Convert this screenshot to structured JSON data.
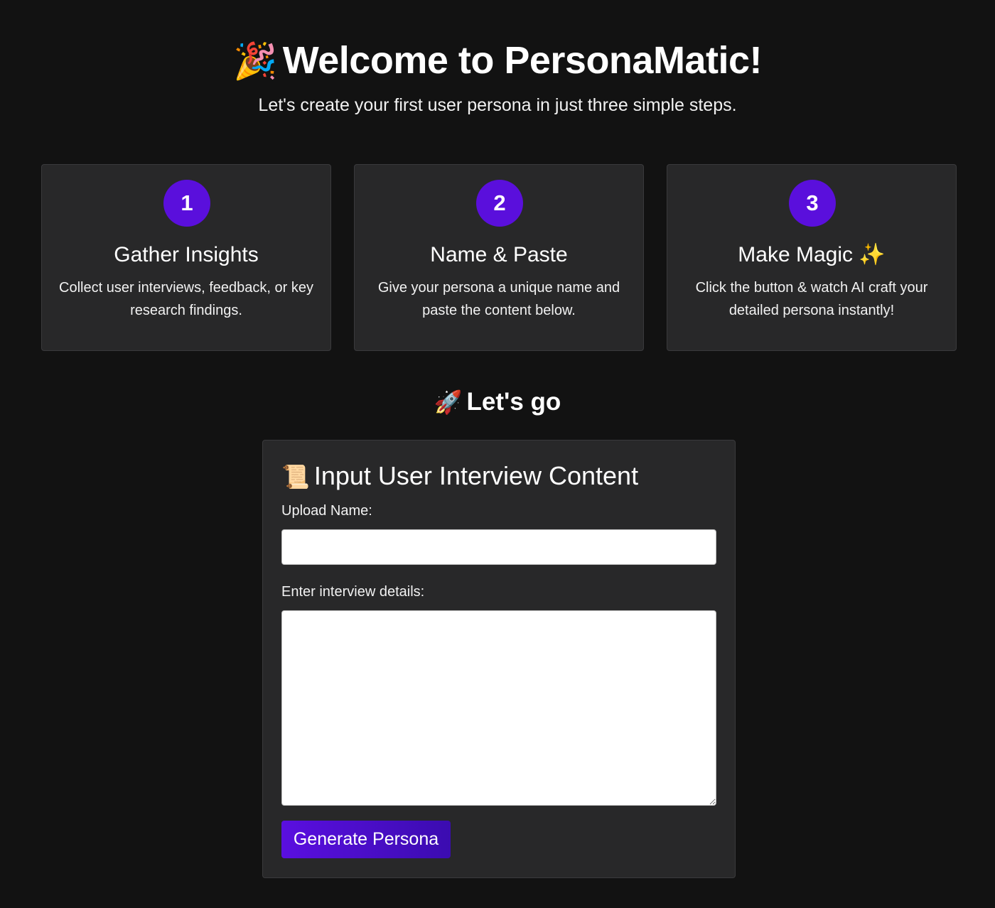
{
  "hero": {
    "emoji": "🎉",
    "title": "Welcome to PersonaMatic!",
    "subtitle": "Let's create your first user persona in just three simple steps."
  },
  "steps": [
    {
      "number": "1",
      "title": "Gather Insights",
      "description": "Collect user interviews, feedback, or key research findings."
    },
    {
      "number": "2",
      "title": "Name & Paste",
      "description": "Give your persona a unique name and paste the content below."
    },
    {
      "number": "3",
      "title": "Make Magic ✨",
      "description": "Click the button & watch AI craft your detailed persona instantly!"
    }
  ],
  "go_section": {
    "emoji": "🚀",
    "heading": "Let's go"
  },
  "form": {
    "emoji": "📜",
    "title": "Input User Interview Content",
    "upload_name_label": "Upload Name:",
    "upload_name_value": "",
    "details_label": "Enter interview details:",
    "details_value": "",
    "submit_label": "Generate Persona"
  },
  "colors": {
    "background": "#121212",
    "card": "#282829",
    "accent": "#5a0fdc"
  }
}
